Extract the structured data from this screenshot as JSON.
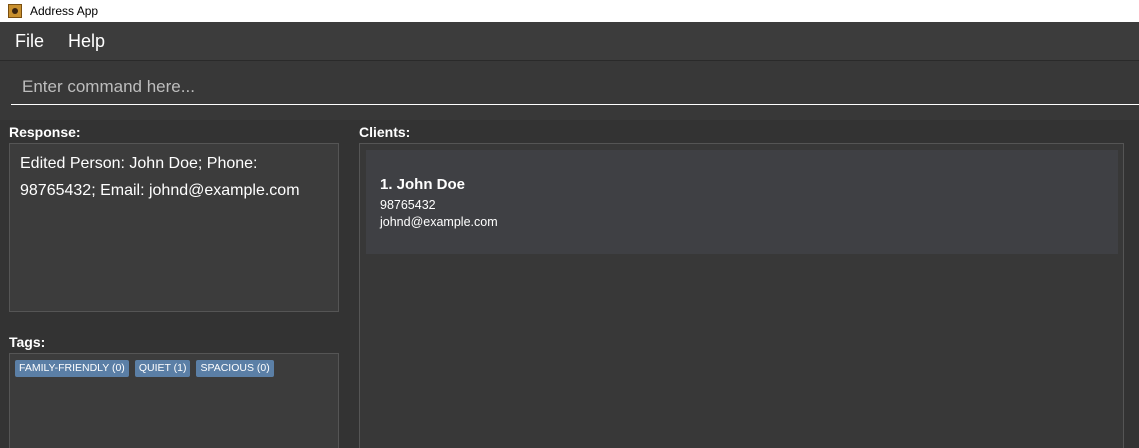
{
  "window": {
    "title": "Address App"
  },
  "menu": {
    "file": "File",
    "help": "Help"
  },
  "command": {
    "placeholder": "Enter command here..."
  },
  "response": {
    "label": "Response:",
    "text": "Edited Person: John Doe; Phone: 98765432; Email: johnd@example.com"
  },
  "tags": {
    "label": "Tags:",
    "items": [
      "FAMILY-FRIENDLY (0)",
      "QUIET (1)",
      "SPACIOUS (0)"
    ]
  },
  "clients": {
    "label": "Clients:",
    "items": [
      {
        "name": "1. John Doe",
        "phone": "98765432",
        "email": "johnd@example.com"
      }
    ]
  },
  "colors": {
    "background": "#333333",
    "tag": "#5b7fa6",
    "card": "#3f4044"
  }
}
